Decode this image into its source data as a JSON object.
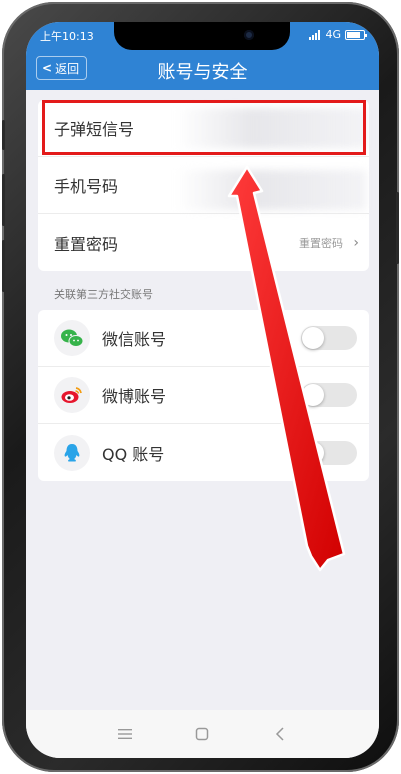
{
  "status_bar": {
    "time": "上午10:13",
    "network": "4G",
    "battery_level": 0.8
  },
  "nav": {
    "back_label": "返回",
    "title": "账号与安全"
  },
  "account_rows": [
    {
      "label": "子弹短信号",
      "value": ""
    },
    {
      "label": "手机号码",
      "value": ""
    },
    {
      "label": "重置密码",
      "value": "重置密码"
    }
  ],
  "social_section": {
    "header": "关联第三方社交账号",
    "items": [
      {
        "label": "微信账号",
        "icon": "wechat-icon",
        "enabled": false
      },
      {
        "label": "微博账号",
        "icon": "weibo-icon",
        "enabled": false
      },
      {
        "label": "QQ 账号",
        "icon": "qq-icon",
        "enabled": false
      }
    ]
  },
  "colors": {
    "header_blue": "#2f83d4",
    "highlight_red": "#e31a1a",
    "wechat_green": "#36b34a",
    "weibo_red": "#e6162d",
    "qq_blue": "#2aa4e8"
  }
}
